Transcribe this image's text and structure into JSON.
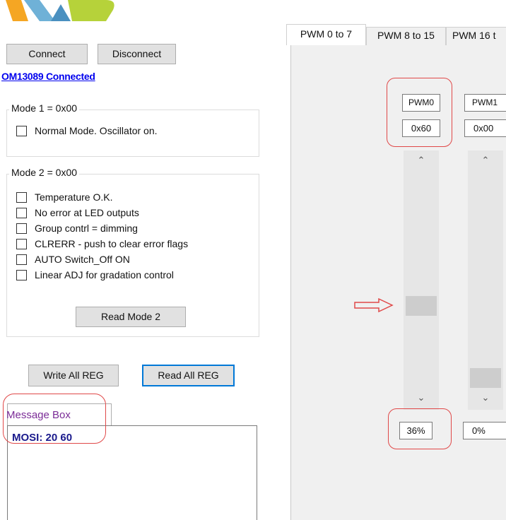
{
  "colors": {
    "logo_orange": "#f5a623",
    "logo_blue": "#6fb1d7",
    "logo_green": "#b6d23a",
    "link_blue": "#0000ee",
    "highlight_red": "#e04848",
    "message_tab_purple": "#7b2c97",
    "message_text_blue": "#1a1a8c",
    "focus_blue": "#0078d7",
    "panel_gray": "#f0f0f0"
  },
  "connection": {
    "connect_label": "Connect",
    "disconnect_label": "Disconnect",
    "status_text": "OM13089 Connected"
  },
  "mode1": {
    "title": "Mode 1 = 0x00",
    "items": [
      {
        "label": "Normal Mode. Oscillator on.",
        "checked": false
      }
    ]
  },
  "mode2": {
    "title": "Mode 2 = 0x00",
    "items": [
      {
        "label": "Temperature O.K.",
        "checked": false
      },
      {
        "label": "No error at LED outputs",
        "checked": false
      },
      {
        "label": "Group contrl = dimming",
        "checked": false
      },
      {
        "label": "CLRERR - push to clear error flags",
        "checked": false
      },
      {
        "label": "AUTO Switch_Off ON",
        "checked": false
      },
      {
        "label": "Linear ADJ for gradation control",
        "checked": false
      }
    ],
    "read_button": "Read Mode 2"
  },
  "registers": {
    "write_all_label": "Write All REG",
    "read_all_label": "Read All REG"
  },
  "message_box": {
    "tab_label": "Message Box",
    "content": "MOSI: 20 60"
  },
  "tabs": [
    {
      "label": "PWM 0 to 7",
      "selected": true
    },
    {
      "label": "PWM 8 to 15",
      "selected": false
    },
    {
      "label": "PWM 16 t",
      "selected": false
    }
  ],
  "channels": [
    {
      "name": "PWM0",
      "hex": "0x60",
      "percent": "36%",
      "level": 0.36
    },
    {
      "name": "PWM1",
      "hex": "0x00",
      "percent": "0%",
      "level": 0.0
    }
  ]
}
